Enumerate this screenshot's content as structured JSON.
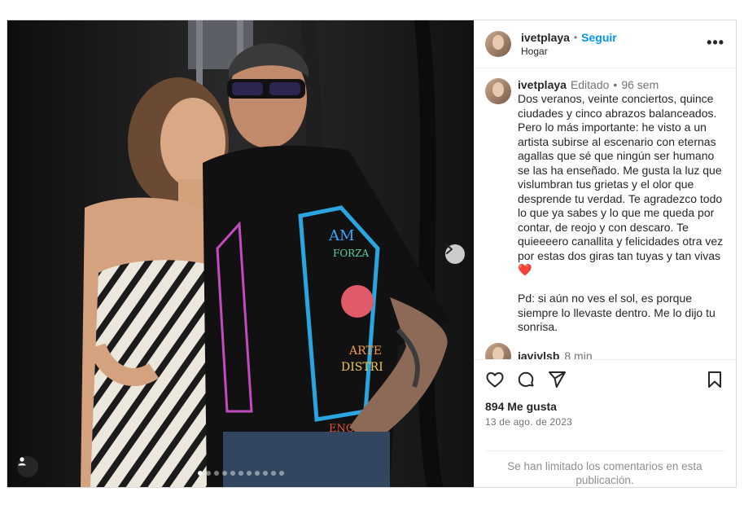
{
  "post": {
    "author": "ivetplaya",
    "follow_label": "Seguir",
    "header_separator": "•",
    "location": "Hogar",
    "more_label": "•••"
  },
  "caption": {
    "username": "ivetplaya",
    "edited_label": "Editado",
    "separator": "•",
    "age": "96 sem",
    "text_part1": "Dos veranos, veinte conciertos, quince ciudades y cinco abrazos balanceados. Pero lo más importante: he visto a un artista subirse al escenario con eternas agallas que sé que ningún ser humano se las ha enseñado. Me gusta la luz que vislumbran tus grietas y el olor que desprende tu verdad. Te agradezco todo lo que ya sabes y lo que me queda por contar, de reojo y con descaro. Te quieeeero canallita y felicidades otra vez por estas dos giras tan tuyas y tan vivas",
    "emoji": "❤️",
    "text_part2": "Pd: si aún no ves el sol, es porque siempre lo llevaste dentro. Me lo dijo tu sonrisa."
  },
  "next_comment": {
    "username": "javivlsb",
    "age": "8 min"
  },
  "stats": {
    "likes": "894 Me gusta",
    "date": "13 de ago. de 2023"
  },
  "comments_notice": "Se han limitado los comentarios en esta publicación.",
  "carousel": {
    "slide_count": 11,
    "active_index": 0
  },
  "icons": {
    "like": "heart-outline-icon",
    "comment": "comment-bubble-icon",
    "share": "paper-plane-icon",
    "save": "bookmark-icon",
    "next": "chevron-right-icon",
    "tags": "user-tag-icon"
  },
  "colors": {
    "follow": "#0095f6",
    "muted": "#737373",
    "border": "#dbdbdb"
  }
}
